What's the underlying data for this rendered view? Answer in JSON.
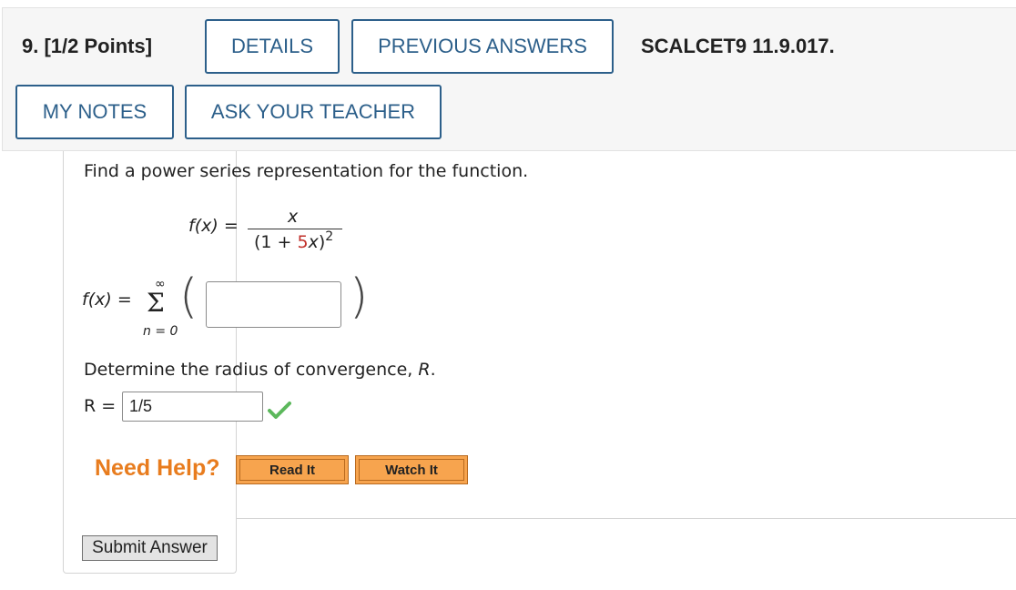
{
  "question": {
    "number": "9.",
    "points": "[1/2 Points]",
    "code": "SCALCET9 11.9.017."
  },
  "header_buttons": {
    "details": "DETAILS",
    "previous_answers": "PREVIOUS ANSWERS",
    "my_notes": "MY NOTES",
    "ask_teacher": "ASK YOUR TEACHER"
  },
  "problem": {
    "prompt": "Find a power series representation for the function.",
    "function_label": "f(x)",
    "equals": "=",
    "numerator": "x",
    "denominator_open": "(1 + ",
    "denominator_coef": "5",
    "denominator_var": "x",
    "denominator_close": ")",
    "exponent": "2",
    "sum_label": "f(x)",
    "sum_upper": "∞",
    "sum_symbol": "Σ",
    "sum_lower": "n = 0",
    "series_answer": ""
  },
  "radius": {
    "prompt_text": "Determine the radius of convergence, ",
    "prompt_var": "R",
    "prompt_end": ".",
    "label": "R =",
    "value": "1/5",
    "status": "correct"
  },
  "help": {
    "label": "Need Help?",
    "read_it": "Read It",
    "watch_it": "Watch It"
  },
  "submit_label": "Submit Answer",
  "colors": {
    "accent": "#2c5f8a",
    "need_help": "#e87c1e",
    "help_button": "#f7a44e",
    "check": "#5cb85c",
    "highlight": "#c0302a"
  }
}
